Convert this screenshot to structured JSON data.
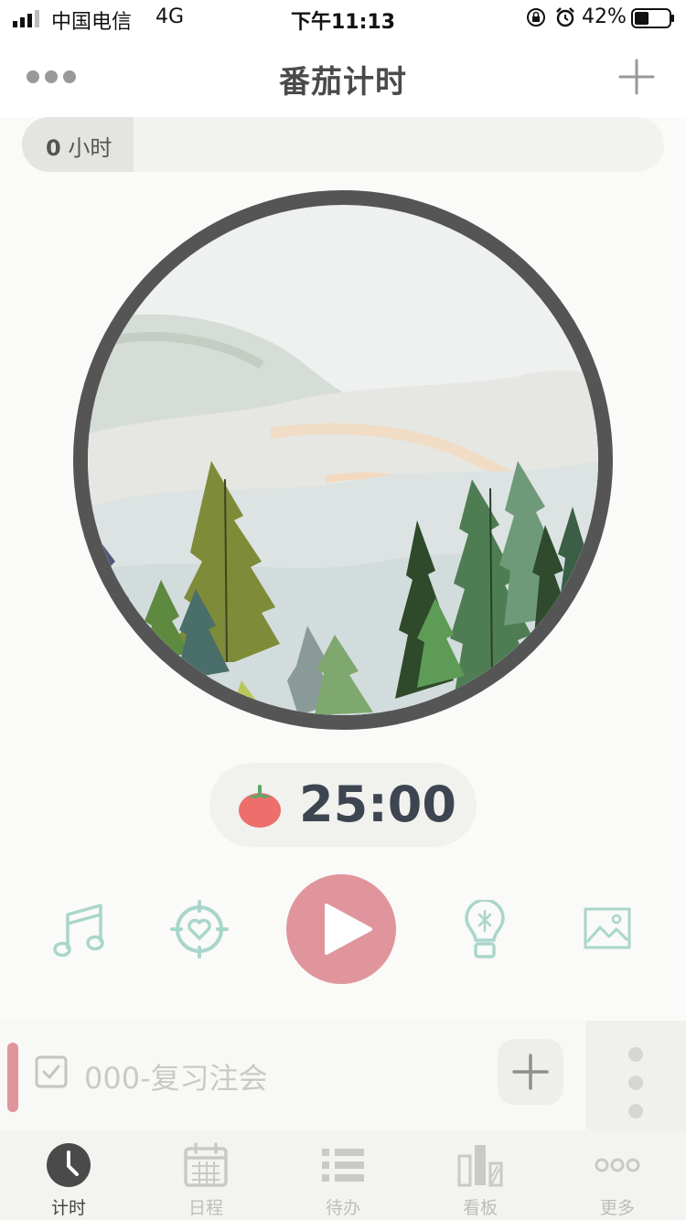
{
  "status_bar": {
    "carrier": "中国电信",
    "network": "4G",
    "time": "下午11:13",
    "battery": "42%"
  },
  "nav": {
    "title": "番茄计时",
    "left_icon": "more-dots-icon",
    "right_icon": "plus-icon"
  },
  "stats": {
    "hours_value": "0",
    "hours_unit": "小时"
  },
  "timer": {
    "value": "25:00",
    "icon": "tomato-icon"
  },
  "controls": [
    {
      "icon": "music-icon"
    },
    {
      "icon": "focus-heart-icon"
    },
    {
      "icon": "play-icon"
    },
    {
      "icon": "lightbulb-icon"
    },
    {
      "icon": "image-icon"
    }
  ],
  "task": {
    "title": "000-复习注会",
    "accent_color": "#e0959c"
  },
  "tabs": [
    {
      "label": "计时",
      "icon": "clock-icon",
      "active": true
    },
    {
      "label": "日程",
      "icon": "calendar-icon",
      "active": false
    },
    {
      "label": "待办",
      "icon": "list-icon",
      "active": false
    },
    {
      "label": "看板",
      "icon": "board-icon",
      "active": false
    },
    {
      "label": "更多",
      "icon": "more-icon",
      "active": false
    }
  ],
  "colors": {
    "accent": "#e0959c",
    "icon_mint": "#a9d6cc",
    "timer_text": "#3d4550",
    "ring": "#555555"
  }
}
